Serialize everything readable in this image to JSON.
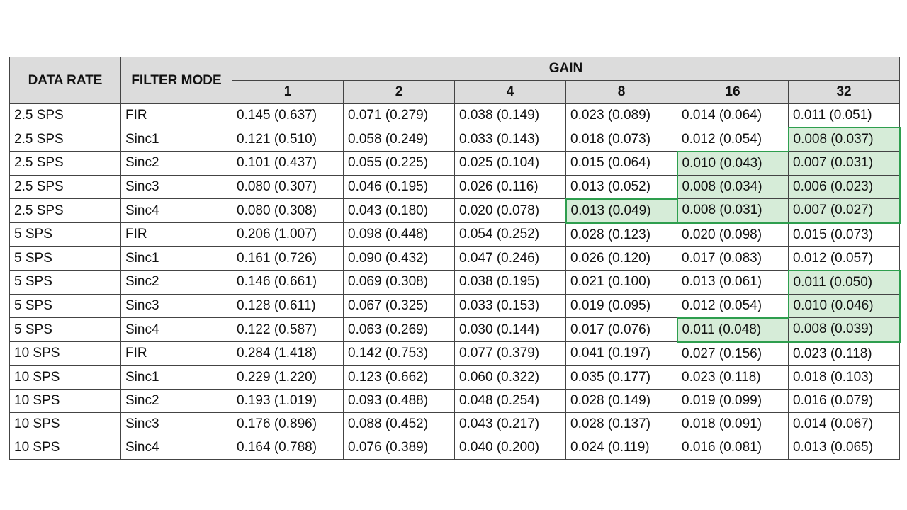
{
  "header": {
    "data_rate": "DATA RATE",
    "filter_mode": "FILTER MODE",
    "gain": "GAIN",
    "gains": [
      "1",
      "2",
      "4",
      "8",
      "16",
      "32"
    ]
  },
  "rows": [
    {
      "rate": "2.5 SPS",
      "filter": "FIR",
      "vals": [
        "0.145 (0.637)",
        "0.071 (0.279)",
        "0.038 (0.149)",
        "0.023 (0.089)",
        "0.014 (0.064)",
        "0.011 (0.051)"
      ]
    },
    {
      "rate": "2.5 SPS",
      "filter": "Sinc1",
      "vals": [
        "0.121 (0.510)",
        "0.058 (0.249)",
        "0.033 (0.143)",
        "0.018 (0.073)",
        "0.012 (0.054)",
        "0.008 (0.037)"
      ]
    },
    {
      "rate": "2.5 SPS",
      "filter": "Sinc2",
      "vals": [
        "0.101 (0.437)",
        "0.055 (0.225)",
        "0.025 (0.104)",
        "0.015 (0.064)",
        "0.010 (0.043)",
        "0.007 (0.031)"
      ]
    },
    {
      "rate": "2.5 SPS",
      "filter": "Sinc3",
      "vals": [
        "0.080 (0.307)",
        "0.046 (0.195)",
        "0.026 (0.116)",
        "0.013 (0.052)",
        "0.008 (0.034)",
        "0.006 (0.023)"
      ]
    },
    {
      "rate": "2.5 SPS",
      "filter": "Sinc4",
      "vals": [
        "0.080 (0.308)",
        "0.043 (0.180)",
        "0.020 (0.078)",
        "0.013 (0.049)",
        "0.008 (0.031)",
        "0.007 (0.027)"
      ]
    },
    {
      "rate": "5 SPS",
      "filter": "FIR",
      "vals": [
        "0.206 (1.007)",
        "0.098 (0.448)",
        "0.054 (0.252)",
        "0.028 (0.123)",
        "0.020 (0.098)",
        "0.015 (0.073)"
      ]
    },
    {
      "rate": "5 SPS",
      "filter": "Sinc1",
      "vals": [
        "0.161 (0.726)",
        "0.090 (0.432)",
        "0.047 (0.246)",
        "0.026 (0.120)",
        "0.017 (0.083)",
        "0.012 (0.057)"
      ]
    },
    {
      "rate": "5 SPS",
      "filter": "Sinc2",
      "vals": [
        "0.146 (0.661)",
        "0.069 (0.308)",
        "0.038 (0.195)",
        "0.021 (0.100)",
        "0.013 (0.061)",
        "0.011 (0.050)"
      ]
    },
    {
      "rate": "5 SPS",
      "filter": "Sinc3",
      "vals": [
        "0.128 (0.611)",
        "0.067 (0.325)",
        "0.033 (0.153)",
        "0.019 (0.095)",
        "0.012 (0.054)",
        "0.010 (0.046)"
      ]
    },
    {
      "rate": "5 SPS",
      "filter": "Sinc4",
      "vals": [
        "0.122 (0.587)",
        "0.063 (0.269)",
        "0.030 (0.144)",
        "0.017 (0.076)",
        "0.011 (0.048)",
        "0.008 (0.039)"
      ]
    },
    {
      "rate": "10 SPS",
      "filter": "FIR",
      "vals": [
        "0.284 (1.418)",
        "0.142 (0.753)",
        "0.077 (0.379)",
        "0.041 (0.197)",
        "0.027 (0.156)",
        "0.023 (0.118)"
      ]
    },
    {
      "rate": "10 SPS",
      "filter": "Sinc1",
      "vals": [
        "0.229 (1.220)",
        "0.123 (0.662)",
        "0.060 (0.322)",
        "0.035 (0.177)",
        "0.023 (0.118)",
        "0.018 (0.103)"
      ]
    },
    {
      "rate": "10 SPS",
      "filter": "Sinc2",
      "vals": [
        "0.193 (1.019)",
        "0.093 (0.488)",
        "0.048 (0.254)",
        "0.028 (0.149)",
        "0.019 (0.099)",
        "0.016 (0.079)"
      ]
    },
    {
      "rate": "10 SPS",
      "filter": "Sinc3",
      "vals": [
        "0.176 (0.896)",
        "0.088 (0.452)",
        "0.043 (0.217)",
        "0.028 (0.137)",
        "0.018 (0.091)",
        "0.014 (0.067)"
      ]
    },
    {
      "rate": "10 SPS",
      "filter": "Sinc4",
      "vals": [
        "0.164 (0.788)",
        "0.076 (0.389)",
        "0.040 (0.200)",
        "0.024 (0.119)",
        "0.016 (0.081)",
        "0.013 (0.065)"
      ]
    }
  ],
  "highlight_color": "#2e9e4e",
  "highlight_fill": "#d6ecd8"
}
